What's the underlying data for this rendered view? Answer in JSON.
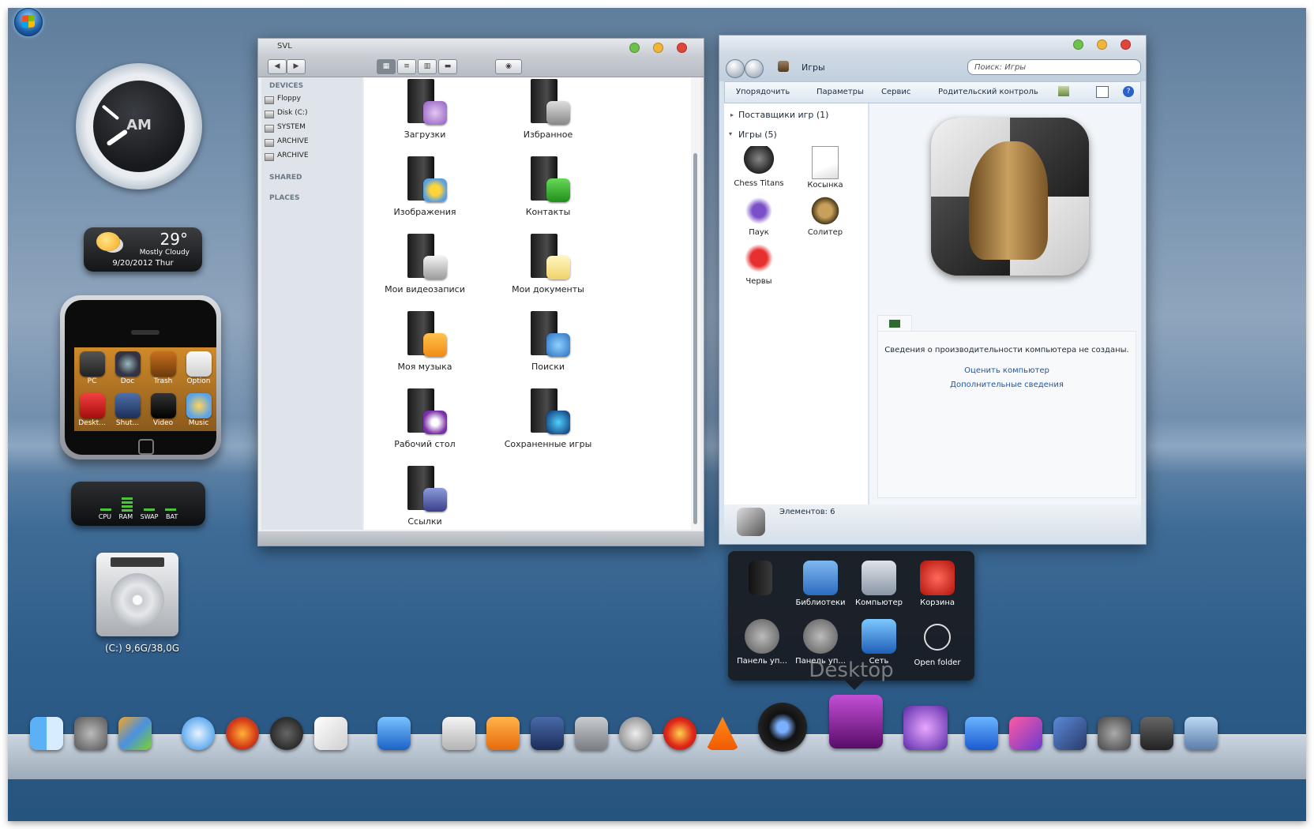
{
  "clock": {
    "ampm": "AM"
  },
  "weather": {
    "temp": "29°",
    "condition": "Mostly Cloudy",
    "date": "9/20/2012 Thur"
  },
  "phone": {
    "apps": [
      "PC",
      "Doc",
      "Trash",
      "Option",
      "Deskt...",
      "Shut...",
      "Video",
      "Music"
    ]
  },
  "meter": {
    "labels": [
      "CPU",
      "RAM",
      "SWAP",
      "BAT"
    ]
  },
  "drive": {
    "label": "(C:) 9,6G/38,0G"
  },
  "finder": {
    "title": "SVL",
    "sidebar": {
      "devices": "DEVICES",
      "device_items": [
        "Floppy",
        "Disk (C:)",
        "SYSTEM",
        "ARCHIVE",
        "ARCHIVE"
      ],
      "shared": "SHARED",
      "places": "PLACES"
    },
    "items": [
      "Загрузки",
      "Избранное",
      "Изображения",
      "Контакты",
      "Мои видеозаписи",
      "Мои документы",
      "Моя музыка",
      "Поиски",
      "Рабочий стол",
      "Сохраненные игры",
      "Ссылки"
    ]
  },
  "explorer": {
    "breadcrumb": "Игры",
    "search_placeholder": "Поиск: Игры",
    "commands": [
      "Упорядочить",
      "Параметры",
      "Сервис",
      "Родительский контроль"
    ],
    "group_providers": "Поставщики игр (1)",
    "group_games": "Игры (5)",
    "games": [
      "Chess Titans",
      "Косынка",
      "Паук",
      "Солитер",
      "Червы"
    ],
    "perf_text": "Сведения о производительности компьютера не созданы.",
    "perf_link1": "Оценить компьютер",
    "perf_link2": "Дополнительные сведения",
    "status": "Элементов: 6"
  },
  "stack": {
    "label": "Desktop",
    "items": [
      "Библиотеки",
      "Компьютер",
      "Корзина",
      "Панель уп...",
      "Панель уп...",
      "Сеть",
      "Open folder"
    ]
  },
  "dock": {
    "icons": [
      "finder-icon",
      "system-preferences-icon",
      "dashboard-icon",
      "safari-icon",
      "firefox-icon",
      "quicktime-icon",
      "textedit-icon",
      "app-store-icon",
      "icloud-icon",
      "itunes-note-icon",
      "utilities-icon",
      "drive-icon",
      "sync-icon",
      "opera-icon",
      "vlc-icon",
      "camera-icon",
      "x-launcher-icon",
      "itunes-icon",
      "app-store-blue-icon",
      "photo-booth-icon",
      "dashboard-widgets-icon",
      "network-icon",
      "keychain-icon",
      "trash-icon"
    ]
  },
  "colors": {
    "accent_green": "#4ec23a",
    "link_blue": "#1f56a6"
  }
}
